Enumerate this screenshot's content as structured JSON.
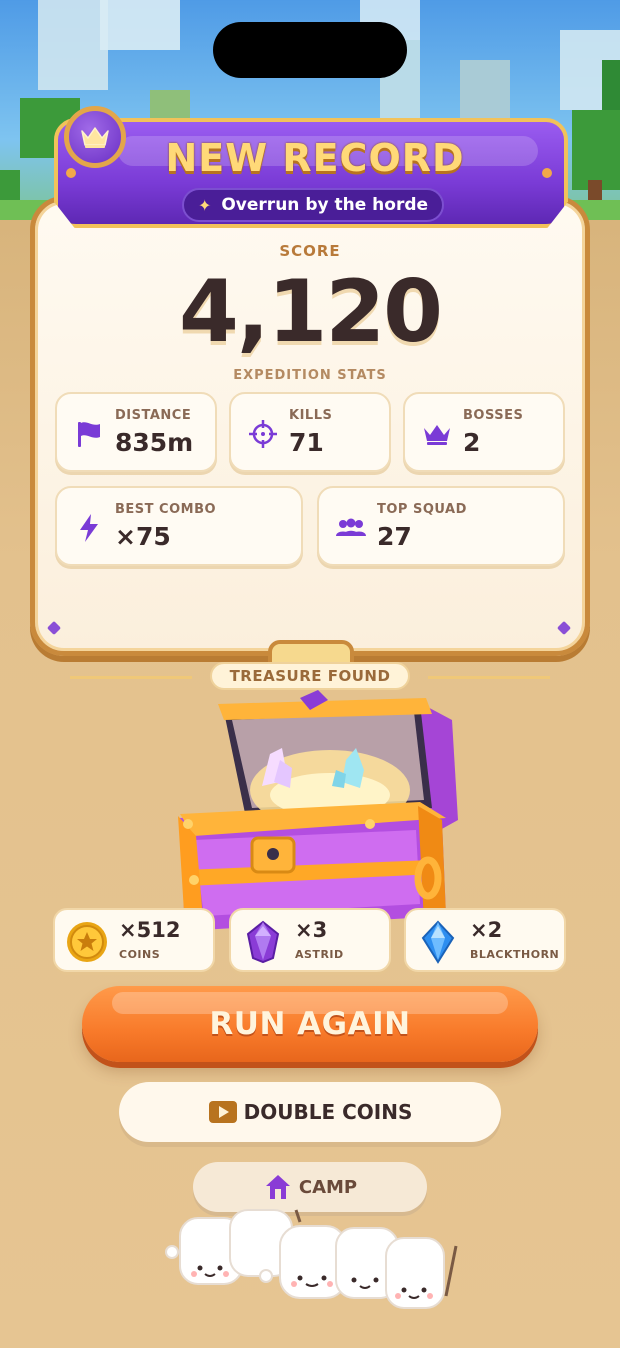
{
  "header": {
    "title": "NEW RECORD",
    "subtitle": "Overrun by the horde",
    "badge_icon": "crown-icon",
    "subtitle_icon": "sparkle-icon"
  },
  "score": {
    "label": "SCORE",
    "value": "4,120"
  },
  "expedition_stats": {
    "label": "EXPEDITION STATS",
    "items": [
      {
        "label": "DISTANCE",
        "value": "835m",
        "icon": "flag-icon"
      },
      {
        "label": "KILLS",
        "value": "71",
        "icon": "crosshair-icon"
      },
      {
        "label": "BOSSES",
        "value": "2",
        "icon": "crown-icon"
      },
      {
        "label": "BEST COMBO",
        "value": "×75",
        "icon": "lightning-icon"
      },
      {
        "label": "TOP SQUAD",
        "value": "27",
        "icon": "group-icon"
      }
    ]
  },
  "treasure": {
    "label": "TREASURE FOUND",
    "rewards": [
      {
        "count": "×512",
        "name": "COINS",
        "icon": "coin-icon"
      },
      {
        "count": "×3",
        "name": "ASTRID",
        "icon": "purple-gem-icon"
      },
      {
        "count": "×2",
        "name": "BLACKTHORN",
        "icon": "blue-gem-icon"
      }
    ]
  },
  "actions": {
    "run_again": "RUN AGAIN",
    "double_coins": "DOUBLE COINS",
    "camp": "CAMP"
  },
  "colors": {
    "accent_purple": "#7a3bd6",
    "accent_gold": "#ffd978",
    "primary_orange": "#f87a2a",
    "text_dark": "#3a2a2a"
  }
}
